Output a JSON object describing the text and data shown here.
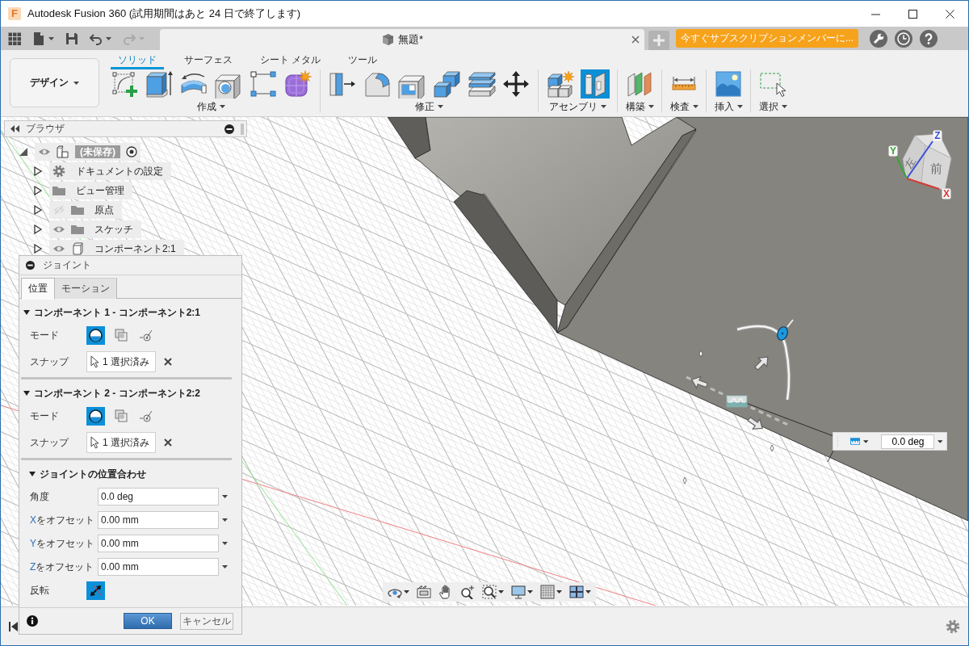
{
  "window": {
    "logo_letter": "F",
    "title": "Autodesk Fusion 360 (試用期間はあと 24 日で終了します)"
  },
  "quick_access": [
    {
      "kind": "apps",
      "dropdown": false,
      "disabled": false
    },
    {
      "kind": "file",
      "dropdown": true,
      "disabled": false
    },
    {
      "kind": "save",
      "dropdown": false,
      "disabled": false
    },
    {
      "kind": "undo",
      "dropdown": true,
      "disabled": false
    },
    {
      "kind": "redo",
      "dropdown": true,
      "disabled": true
    }
  ],
  "document_tab": {
    "title": "無題*"
  },
  "subscribe_button": {
    "label": "今すぐサブスクリプションメンバーに..."
  },
  "workspace": {
    "label": "デザイン"
  },
  "toolbar_tabs": [
    {
      "label": "ソリッド",
      "selected": true
    },
    {
      "label": "サーフェス",
      "selected": false
    },
    {
      "label": "シート メタル",
      "selected": false
    },
    {
      "label": "ツール",
      "selected": false
    }
  ],
  "tool_groups": [
    {
      "label": "作成",
      "tools": [
        {
          "kind": "sketch",
          "active": false
        },
        {
          "kind": "extrude",
          "active": false
        },
        {
          "kind": "revolve",
          "active": false
        },
        {
          "kind": "hole",
          "active": false
        },
        {
          "kind": "pattern",
          "active": false
        },
        {
          "kind": "form",
          "active": false
        }
      ]
    },
    {
      "label": "修正",
      "tools": [
        {
          "kind": "press_pull",
          "active": false
        },
        {
          "kind": "fillet",
          "active": false
        },
        {
          "kind": "shell",
          "active": false
        },
        {
          "kind": "combine",
          "active": false
        },
        {
          "kind": "offset_face",
          "active": false
        },
        {
          "kind": "move",
          "active": false
        }
      ]
    },
    {
      "label": "アセンブリ",
      "tools": [
        {
          "kind": "new_component",
          "active": false
        },
        {
          "kind": "joint",
          "active": true
        }
      ]
    },
    {
      "label": "構築",
      "tools": [
        {
          "kind": "plane",
          "active": false
        }
      ]
    },
    {
      "label": "検査",
      "tools": [
        {
          "kind": "measure",
          "active": false
        }
      ]
    },
    {
      "label": "挿入",
      "tools": [
        {
          "kind": "insert_image",
          "active": false
        }
      ]
    },
    {
      "label": "選択",
      "tools": [
        {
          "kind": "select",
          "active": false
        }
      ]
    }
  ],
  "browser": {
    "title": "ブラウザ",
    "tree": [
      {
        "label": "(未保存)",
        "kind": "assembly",
        "eye": {
          "visible": true
        },
        "expanded": true,
        "selected": true,
        "active": true,
        "children": [
          {
            "label": "ドキュメントの設定",
            "kind": "settings",
            "expanded": false,
            "selected": false,
            "active": false
          },
          {
            "label": "ビュー管理",
            "kind": "folder",
            "expanded": false,
            "selected": false,
            "active": false
          },
          {
            "label": "原点",
            "kind": "folder",
            "eye": {
              "visible": false
            },
            "expanded": false,
            "selected": false,
            "active": false
          },
          {
            "label": "スケッチ",
            "kind": "folder",
            "eye": {
              "visible": true
            },
            "expanded": false,
            "selected": false,
            "active": false
          },
          {
            "label": "コンポーネント2:1",
            "kind": "component",
            "eye": {
              "visible": true
            },
            "expanded": false,
            "selected": false,
            "active": false
          }
        ]
      }
    ]
  },
  "joint_dialog": {
    "title": "ジョイント",
    "tabs": [
      {
        "label": "位置",
        "selected": true
      },
      {
        "label": "モーション",
        "selected": false
      }
    ],
    "component_sections": [
      {
        "title": "コンポーネント 1 - コンポーネント2:1",
        "expanded": true,
        "mode_label": "モード",
        "modes": [
          {
            "kind": "simple",
            "selected": true
          },
          {
            "kind": "between",
            "selected": false
          },
          {
            "kind": "tangent",
            "selected": false
          }
        ],
        "snap_label": "スナップ",
        "snap_value": "1 選択済み"
      },
      {
        "title": "コンポーネント 2 - コンポーネント2:2",
        "expanded": true,
        "mode_label": "モード",
        "modes": [
          {
            "kind": "simple",
            "selected": true
          },
          {
            "kind": "between",
            "selected": false
          },
          {
            "kind": "tangent",
            "selected": false
          }
        ],
        "snap_label": "スナップ",
        "snap_value": "1 選択済み"
      }
    ],
    "alignment": {
      "title": "ジョイントの位置合わせ",
      "expanded": true,
      "fields": [
        {
          "label": "角度",
          "value": "0.0 deg"
        },
        {
          "prefix": "X",
          "label": "をオフセット",
          "value": "0.00 mm"
        },
        {
          "prefix": "Y",
          "label": "をオフセット",
          "value": "0.00 mm"
        },
        {
          "prefix": "Z",
          "label": "をオフセット",
          "value": "0.00 mm"
        }
      ],
      "flip_label": "反転"
    },
    "ok_label": "OK",
    "cancel_label": "キャンセル"
  },
  "viewport": {
    "view_cube": {
      "faces": [
        "左",
        "前"
      ],
      "axes": [
        {
          "label": "Z",
          "color": "#3b4fd6"
        },
        {
          "label": "Y",
          "color": "#3ca33c"
        },
        {
          "label": "X",
          "color": "#d83a3a"
        }
      ]
    },
    "angle_input": {
      "value": "0.0 deg"
    },
    "navigation_bar": [
      {
        "kind": "orbit",
        "dropdown": true
      },
      {
        "kind": "look_at",
        "dropdown": false
      },
      {
        "kind": "pan",
        "dropdown": false
      },
      {
        "kind": "zoom",
        "dropdown": false
      },
      {
        "kind": "fit",
        "dropdown": true
      },
      {
        "kind": "display",
        "dropdown": true
      },
      {
        "kind": "grid",
        "dropdown": true
      },
      {
        "kind": "viewports",
        "dropdown": true
      }
    ]
  }
}
